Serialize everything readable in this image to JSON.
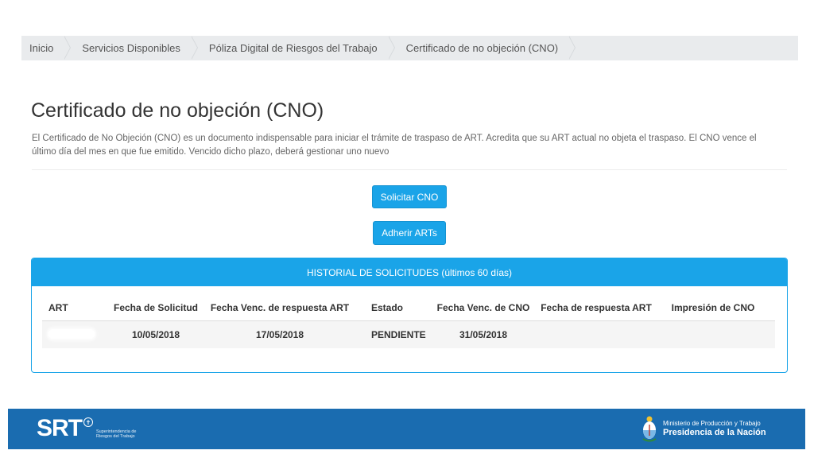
{
  "breadcrumb": [
    {
      "label": "Inicio"
    },
    {
      "label": "Servicios Disponibles"
    },
    {
      "label": "Póliza Digital de Riesgos del Trabajo"
    },
    {
      "label": "Certificado de no objeción (CNO)"
    }
  ],
  "page": {
    "title": "Certificado de no objeción (CNO)",
    "description": "El Certificado de No Objeción (CNO) es un documento indispensable para iniciar el trámite de traspaso de ART. Acredita que su ART actual no objeta el traspaso. El CNO vence el último día del mes en que fue emitido. Vencido dicho plazo, deberá gestionar uno nuevo"
  },
  "buttons": {
    "solicitar": "Solicitar CNO",
    "adherir": "Adherir ARTs"
  },
  "history": {
    "heading": "HISTORIAL DE SOLICITUDES (últimos 60 días)",
    "columns": [
      "ART",
      "Fecha de Solicitud",
      "Fecha Venc. de respuesta ART",
      "Estado",
      "Fecha Venc. de CNO",
      "Fecha de respuesta ART",
      "Impresión de CNO"
    ],
    "rows": [
      {
        "art": "",
        "fecha_solicitud": "10/05/2018",
        "fecha_venc_respuesta": "17/05/2018",
        "estado": "PENDIENTE",
        "fecha_venc_cno": "31/05/2018",
        "fecha_respuesta": "",
        "impresion": ""
      }
    ]
  },
  "footer": {
    "srt_logo": "SRT",
    "srt_subtitle_1": "Superintendencia de",
    "srt_subtitle_2": "Riesgos del Trabajo",
    "gov_line1": "Ministerio de Producción y Trabajo",
    "gov_line2": "Presidencia de la Nación"
  },
  "colors": {
    "accent": "#1aa4e8",
    "footer": "#1a6cb0",
    "breadcrumb_bg": "#e9ebed"
  }
}
